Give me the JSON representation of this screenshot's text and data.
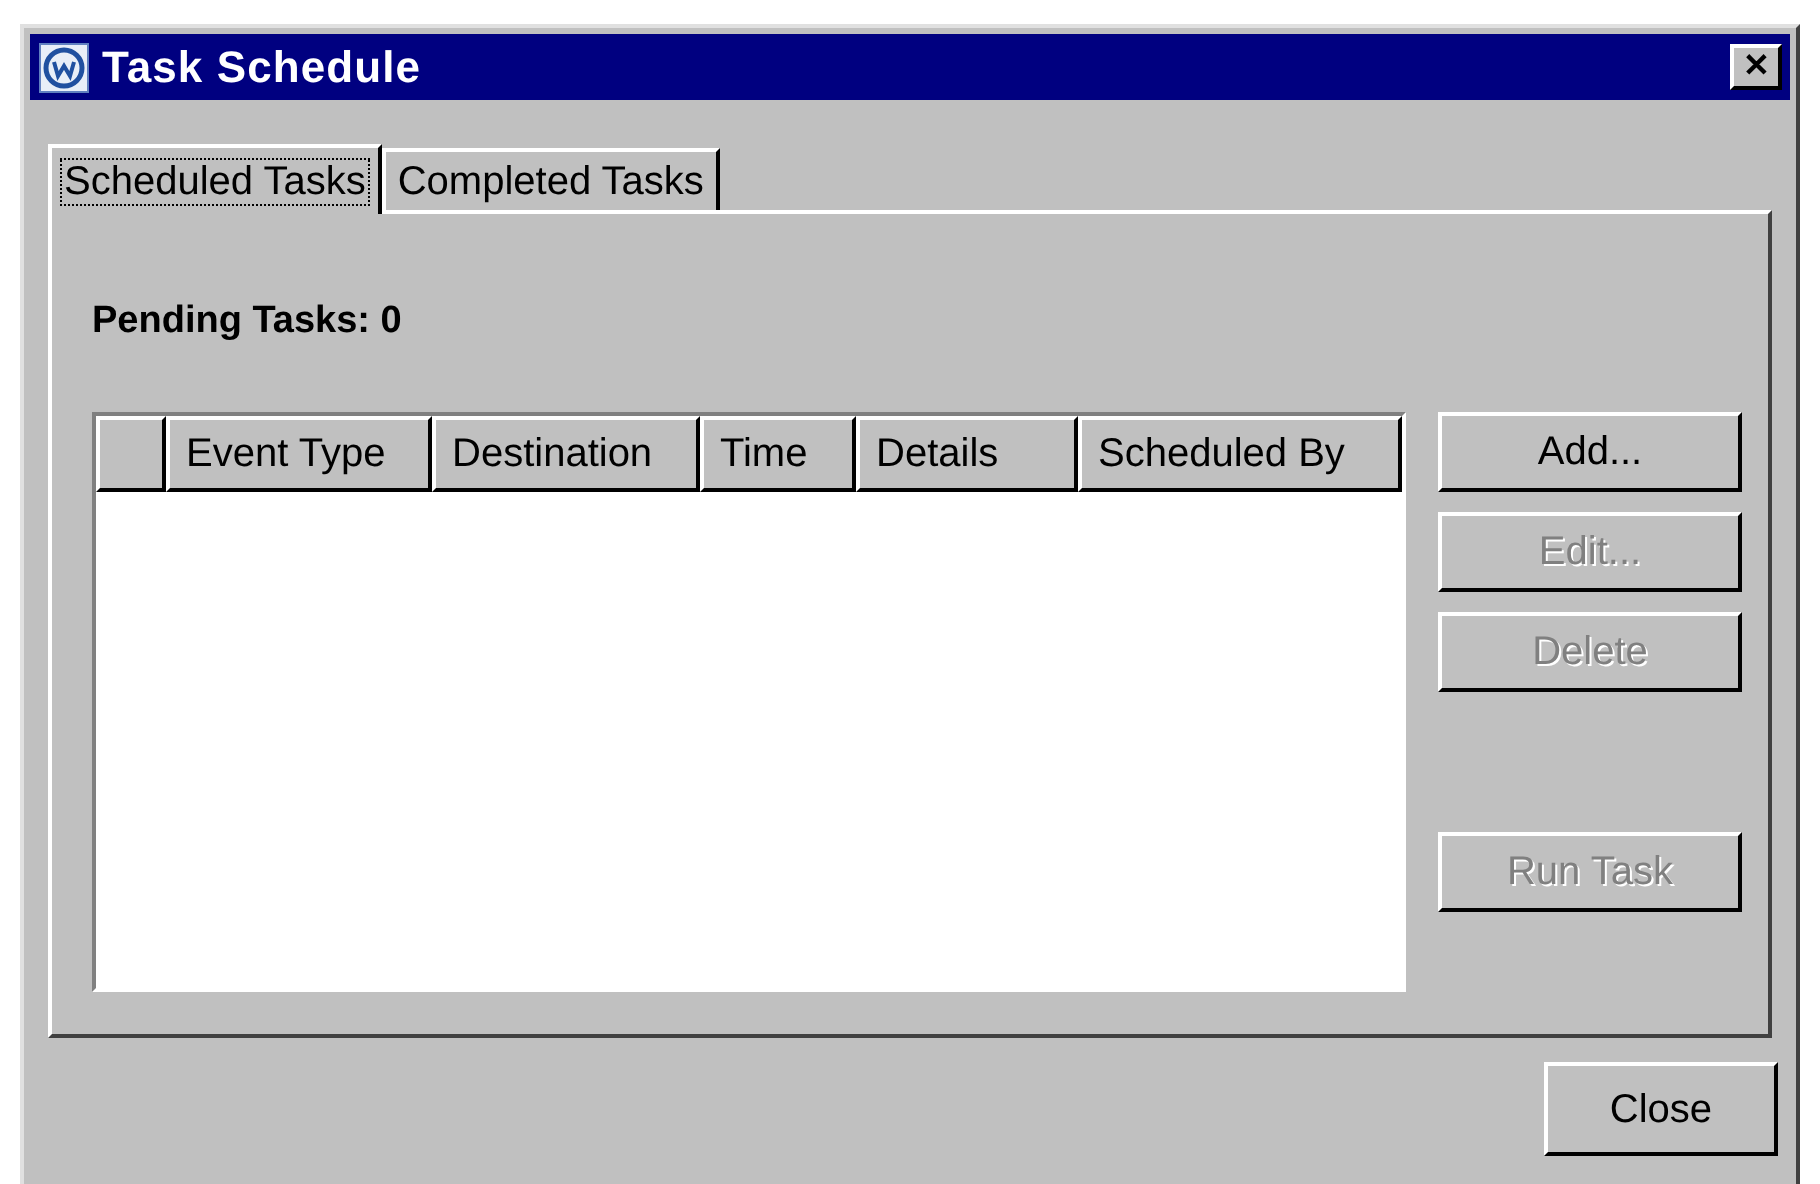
{
  "window": {
    "title": "Task Schedule",
    "close_label": "✕"
  },
  "tabs": [
    {
      "label": "Scheduled Tasks",
      "selected": true
    },
    {
      "label": "Completed Tasks",
      "selected": false
    }
  ],
  "pending_label": "Pending Tasks: 0",
  "table": {
    "columns": [
      "",
      "Event Type",
      "Destination",
      "Time",
      "Details",
      "Scheduled By"
    ]
  },
  "side_buttons": [
    {
      "label": "Add...",
      "disabled": false
    },
    {
      "label": "Edit...",
      "disabled": true
    },
    {
      "label": "Delete",
      "disabled": true
    },
    {
      "label": "Run Task",
      "disabled": true
    }
  ],
  "footer_button": {
    "label": "Close"
  }
}
